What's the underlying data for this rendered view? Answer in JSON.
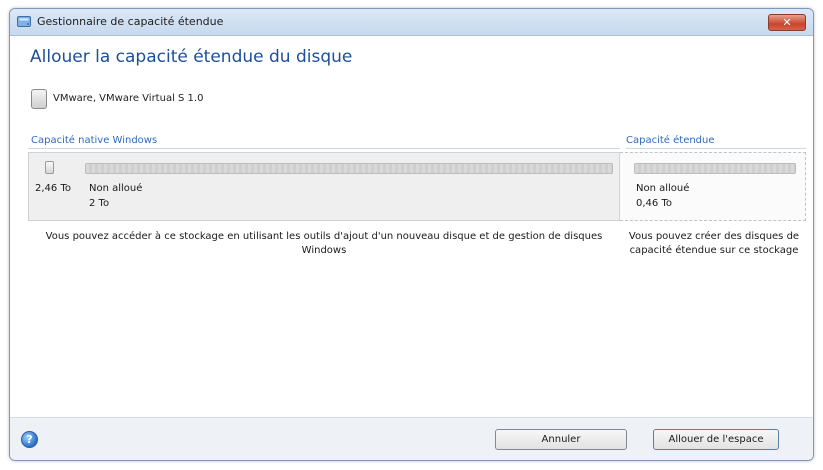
{
  "window": {
    "title": "Gestionnaire de capacité étendue",
    "close_glyph": "✕"
  },
  "page": {
    "heading": "Allouer la capacité étendue du disque",
    "device_name": "VMware, VMware Virtual S 1.0"
  },
  "native": {
    "label": "Capacité native Windows",
    "total": "2,46 To",
    "status": "Non alloué",
    "size": "2 To",
    "description": "Vous pouvez accéder à ce stockage en utilisant les outils d'ajout d'un nouveau disque et de gestion de disques Windows"
  },
  "extended": {
    "label": "Capacité étendue",
    "status": "Non alloué",
    "size": "0,46 To",
    "description": "Vous pouvez créer des disques de capacité étendue sur ce stockage"
  },
  "footer": {
    "help_glyph": "?",
    "cancel_label": "Annuler",
    "allocate_label": "Allouer de l'espace"
  },
  "icons": {
    "app": "disk-manager-icon",
    "close": "close-icon",
    "device": "hard-disk-icon",
    "help": "help-icon"
  },
  "colors": {
    "heading": "#1d4f9a",
    "section_label": "#2e6bbf",
    "close_button": "#c8452b"
  }
}
